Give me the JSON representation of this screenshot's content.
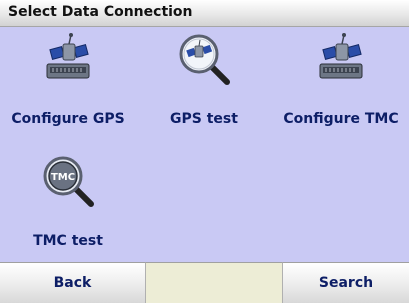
{
  "window": {
    "title": "Select Data Connection"
  },
  "menu": {
    "items": [
      {
        "label": "Configure GPS",
        "icon": "gps-satellite-icon"
      },
      {
        "label": "GPS test",
        "icon": "gps-test-magnifier-icon"
      },
      {
        "label": "Configure TMC",
        "icon": "tmc-satellite-icon"
      },
      {
        "label": "TMC test",
        "icon": "tmc-test-magnifier-icon"
      }
    ]
  },
  "footer": {
    "back_label": "Back",
    "search_label": "Search"
  },
  "colors": {
    "background": "#c9c9f4",
    "label_text": "#0d1e66",
    "footer_middle": "#ededd6"
  }
}
